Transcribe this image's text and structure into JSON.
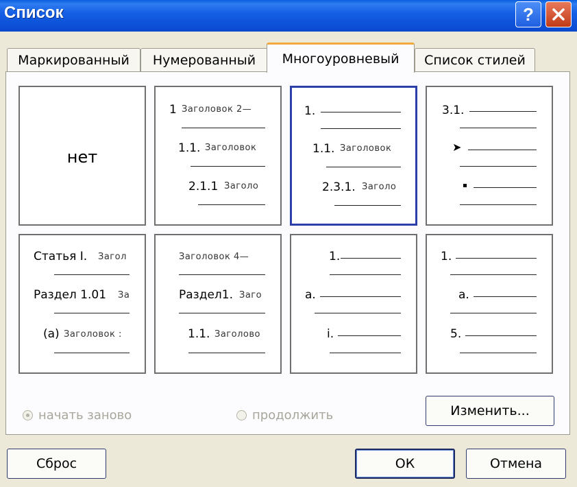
{
  "window": {
    "title": "Список"
  },
  "title_buttons": {
    "help_label": "?"
  },
  "tabs": [
    {
      "label": "Маркированный",
      "active": false
    },
    {
      "label": "Нумерованный",
      "active": false
    },
    {
      "label": "Многоуровневый",
      "active": true
    },
    {
      "label": "Список стилей",
      "active": false
    }
  ],
  "gallery": {
    "none_label": "нет",
    "cell2": {
      "nums": [
        "1",
        "1.1.",
        "2.1.1"
      ],
      "heads": [
        "Заголовок 2—",
        "Заголовок",
        "Заголо"
      ]
    },
    "cell3": {
      "nums": [
        "1.",
        "1.1.",
        "2.3.1."
      ],
      "heads": [
        "Заголовок",
        "Заголо"
      ]
    },
    "cell4": {
      "nums": [
        "3.1."
      ],
      "bullets": [
        "arrow-bullet",
        "square-bullet"
      ]
    },
    "cell5": {
      "nums": [
        "Статья I.",
        "Раздел 1.01",
        "(a)"
      ],
      "heads": [
        "Загол",
        "За",
        "Заголовок :"
      ]
    },
    "cell6": {
      "nums": [
        "Раздел1.",
        "1.1."
      ],
      "heads": [
        "Заголовок 4—",
        "Заго",
        "Заголово"
      ]
    },
    "cell7": {
      "nums": [
        "1.",
        "a.",
        "i."
      ]
    },
    "cell8": {
      "nums": [
        "1.",
        "a.",
        "5."
      ]
    }
  },
  "options": {
    "restart_label": "начать заново",
    "continue_label": "продолжить",
    "restart_checked": true
  },
  "buttons": {
    "modify": "Изменить...",
    "reset": "Сброс",
    "ok": "ОК",
    "cancel": "Отмена"
  },
  "colors": {
    "titlebar": "#1560e6",
    "selection_border": "#2a3fa8",
    "dialog_bg": "#ece9d8",
    "active_tab_accent": "#f3a83c"
  }
}
